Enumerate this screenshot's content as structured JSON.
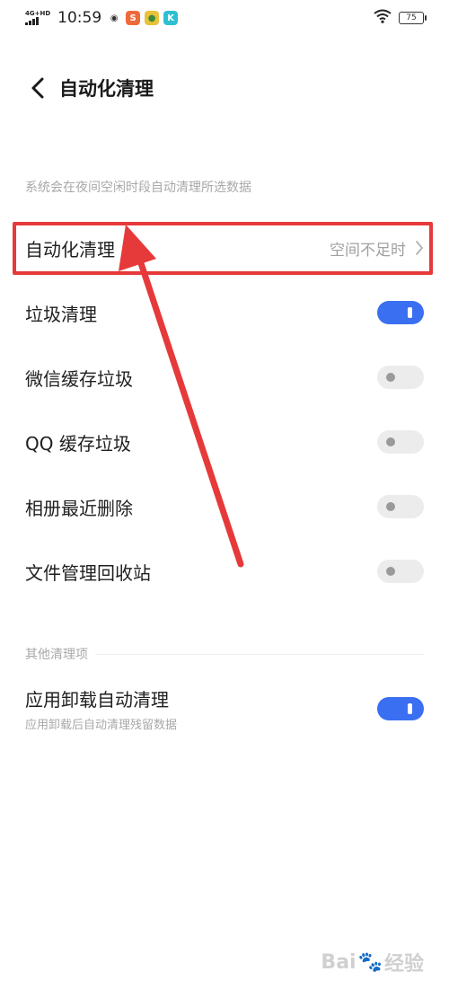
{
  "status_bar": {
    "network_type": "4G+HD",
    "time": "10:59",
    "battery_level": "75",
    "app_icons": [
      {
        "name": "weibo-icon",
        "glyph": "◉",
        "color": "#ffffff",
        "text_color": "#333333"
      },
      {
        "name": "orange-app-icon",
        "glyph": "S",
        "color": "#ef6a3a",
        "text_color": "#ffffff"
      },
      {
        "name": "green-app-icon",
        "glyph": "●",
        "color": "#e8c23a",
        "text_color": "#3a8a3a"
      },
      {
        "name": "k-app-icon",
        "glyph": "K",
        "color": "#2ec0d0",
        "text_color": "#ffffff"
      }
    ]
  },
  "header": {
    "title": "自动化清理"
  },
  "description": "系统会在夜间空闲时段自动清理所选数据",
  "auto_clean_row": {
    "label": "自动化清理",
    "value": "空间不足时"
  },
  "toggle_rows": [
    {
      "label": "垃圾清理",
      "state": "on"
    },
    {
      "label": "微信缓存垃圾",
      "state": "off"
    },
    {
      "label": "QQ 缓存垃圾",
      "state": "off"
    },
    {
      "label": "相册最近删除",
      "state": "off"
    },
    {
      "label": "文件管理回收站",
      "state": "off"
    }
  ],
  "other_section": {
    "title": "其他清理项",
    "item": {
      "label": "应用卸载自动清理",
      "sublabel": "应用卸载后自动清理残留数据",
      "state": "on"
    }
  },
  "colors": {
    "accent": "#3b6ff2",
    "annotation_red": "#e63a3a"
  },
  "watermark": {
    "text_left": "Bai",
    "text_right": "经验"
  }
}
